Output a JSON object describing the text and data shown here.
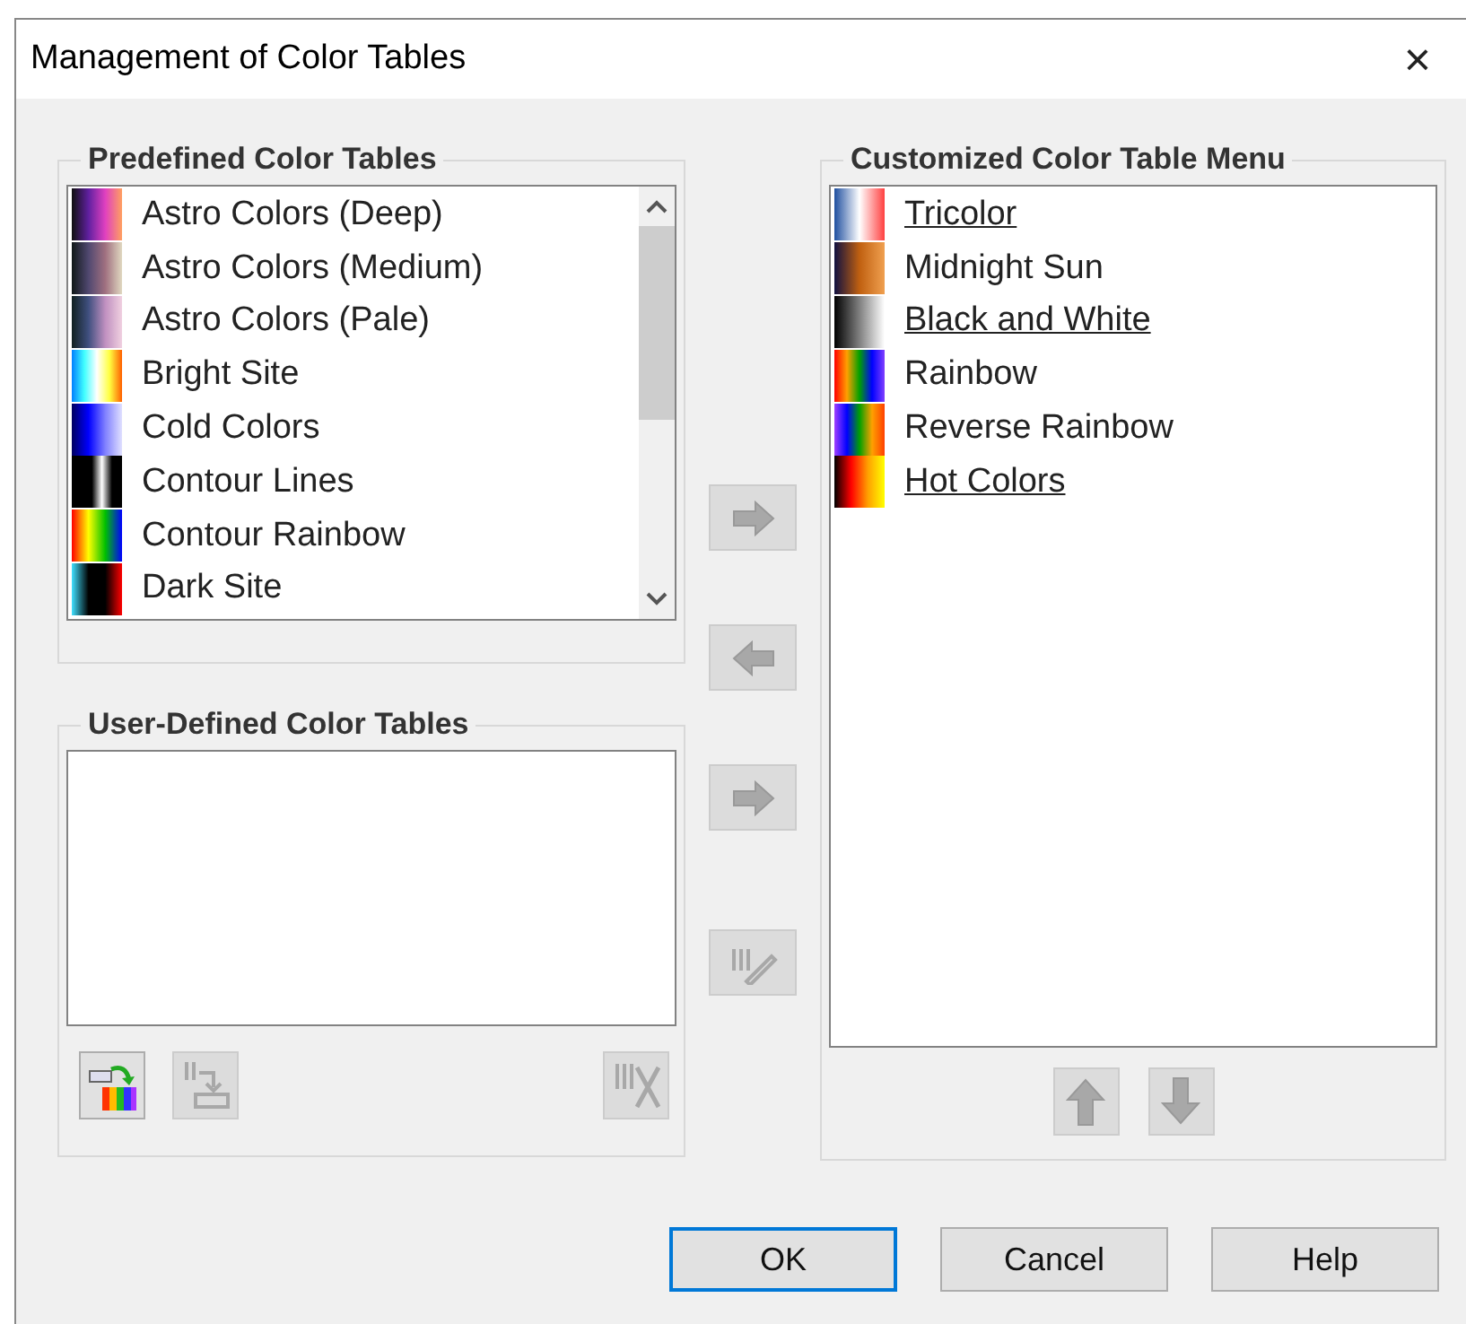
{
  "window": {
    "title": "Management of Color Tables",
    "close": "×"
  },
  "predefined": {
    "title": "Predefined Color Tables",
    "items": [
      {
        "label": "Astro Colors (Deep)"
      },
      {
        "label": "Astro Colors (Medium)"
      },
      {
        "label": "Astro Colors (Pale)"
      },
      {
        "label": "Bright Site"
      },
      {
        "label": "Cold Colors"
      },
      {
        "label": "Contour Lines"
      },
      {
        "label": "Contour Rainbow"
      },
      {
        "label": "Dark Site"
      }
    ]
  },
  "user_defined": {
    "title": "User-Defined Color Tables"
  },
  "user_tools": [
    {
      "kind": "new",
      "disabled": false
    },
    {
      "kind": "import",
      "disabled": true
    },
    {
      "kind": "delete",
      "disabled": true
    }
  ],
  "transfer_buttons": [
    {
      "kind": "right",
      "disabled": true
    },
    {
      "kind": "left",
      "disabled": true
    },
    {
      "kind": "right",
      "disabled": true
    },
    {
      "kind": "edit",
      "disabled": true
    }
  ],
  "customized": {
    "title": "Customized Color Table Menu",
    "items": [
      {
        "label": "Tricolor",
        "underlined": true
      },
      {
        "label": "Midnight Sun",
        "underlined": false
      },
      {
        "label": "Black and White",
        "underlined": true
      },
      {
        "label": "Rainbow",
        "underlined": false
      },
      {
        "label": "Reverse Rainbow",
        "underlined": false
      },
      {
        "label": "Hot Colors",
        "underlined": true
      }
    ]
  },
  "order_buttons": [
    {
      "kind": "up",
      "disabled": true
    },
    {
      "kind": "down",
      "disabled": true
    }
  ],
  "buttons": [
    {
      "label": "OK",
      "selected": true
    },
    {
      "label": "Cancel",
      "selected": false
    },
    {
      "label": "Help",
      "selected": false
    }
  ]
}
